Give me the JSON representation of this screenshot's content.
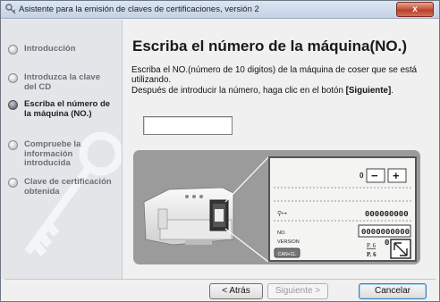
{
  "window": {
    "title": "Asistente para la emisión de claves de certificaciones, versión 2",
    "close_label": "x"
  },
  "sidebar": {
    "steps": [
      {
        "label": "Introducción",
        "active": false
      },
      {
        "label": "Introduzca la clave del CD",
        "active": false
      },
      {
        "label": "Escriba el número de la máquina (NO.)",
        "active": true
      },
      {
        "label": "Compruebe la información introducida",
        "active": false
      },
      {
        "label": "Clave de certificación obtenida",
        "active": false
      }
    ]
  },
  "main": {
    "heading": "Escriba el número de la máquina(NO.)",
    "instruction_line1": "Escriba el NO.(número de 10 digitos) de la máquina de coser que se está utilizando.",
    "instruction_line2_prefix": "Después de introducir la número, haga clic en el botón ",
    "instruction_line2_bold": "[Siguiente]",
    "instruction_line2_suffix": ".",
    "machine_number_value": ""
  },
  "lcd": {
    "counter": "0",
    "minus": "−",
    "plus": "+",
    "row1_value": "000000000",
    "no_label": "NO.",
    "no_value": "0000000000",
    "version_label": "VERSION",
    "version_value": "0.00",
    "page_top": "P. 6",
    "page_bottom": "P. 6",
    "small_button": "CAN+CL"
  },
  "buttons": {
    "back": "< Atrás",
    "next": "Siguiente >",
    "cancel": "Cancelar"
  }
}
